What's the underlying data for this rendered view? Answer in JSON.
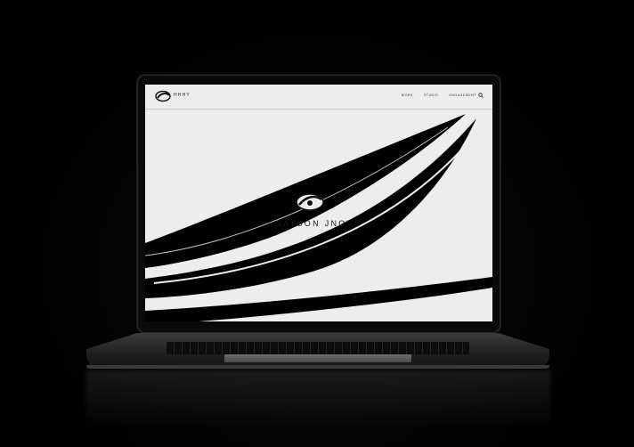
{
  "site": {
    "logo_text": "HHHY",
    "nav": [
      "WORK",
      "STUDIO",
      "ENGAGEMENT"
    ],
    "hero_title": "SATSON JNOVE"
  },
  "colors": {
    "background": "#000000",
    "screen": "#ededed",
    "swoosh": "#000000"
  },
  "icons": [
    "logo-mark",
    "search-icon",
    "emblem-icon"
  ]
}
